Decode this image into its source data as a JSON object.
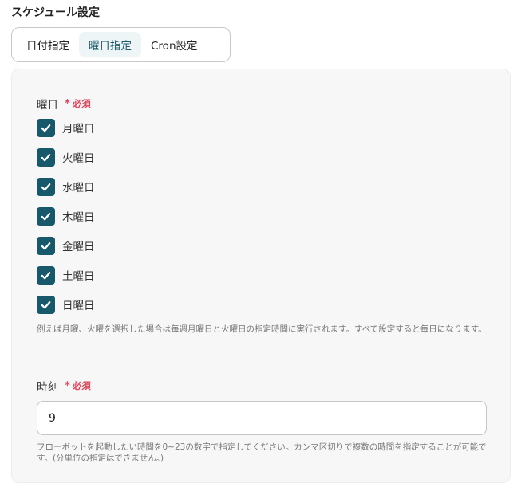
{
  "section": {
    "title": "スケジュール設定"
  },
  "tabs": [
    {
      "label": "日付指定",
      "active": false
    },
    {
      "label": "曜日指定",
      "active": true
    },
    {
      "label": "Cron設定",
      "active": false
    }
  ],
  "weekday_field": {
    "label": "曜日",
    "required_mark": "*",
    "required_text": "必須",
    "options": [
      {
        "label": "月曜日",
        "checked": true
      },
      {
        "label": "火曜日",
        "checked": true
      },
      {
        "label": "水曜日",
        "checked": true
      },
      {
        "label": "木曜日",
        "checked": true
      },
      {
        "label": "金曜日",
        "checked": true
      },
      {
        "label": "土曜日",
        "checked": true
      },
      {
        "label": "日曜日",
        "checked": true
      }
    ],
    "help": "例えば月曜、火曜を選択した場合は毎週月曜日と火曜日の指定時間に実行されます。すべて設定すると毎日になります。"
  },
  "time_field": {
    "label": "時刻",
    "required_mark": "*",
    "required_text": "必須",
    "value": "9",
    "help": "フローボットを起動したい時間を0~23の数字で指定してください。カンマ区切りで複数の時間を指定することが可能です。(分単位の指定はできません。)"
  },
  "colors": {
    "accent": "#17596a",
    "required": "#e0445a",
    "active_tab_bg": "#eef5f7"
  }
}
